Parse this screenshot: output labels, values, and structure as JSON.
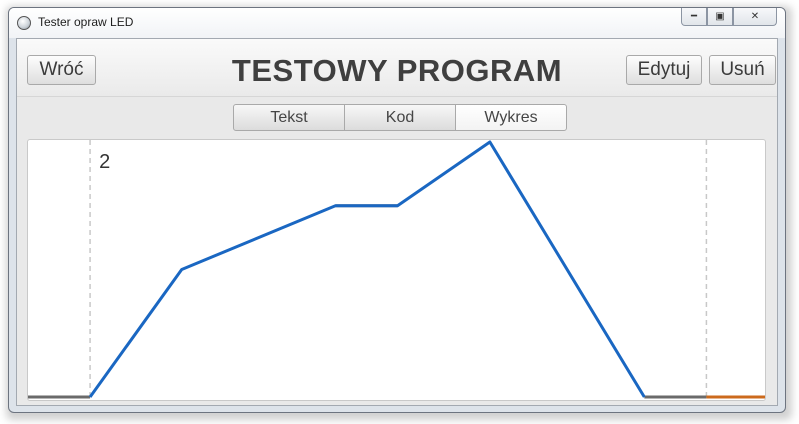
{
  "window": {
    "title": "Tester opraw LED",
    "controls": {
      "minimize_icon": "minimize-icon",
      "maximize_icon": "maximize-icon",
      "close_icon": "close-icon"
    }
  },
  "header": {
    "title": "TESTOWY PROGRAM",
    "back_label": "Wróć",
    "edit_label": "Edytuj",
    "delete_label": "Usuń"
  },
  "tabs": [
    {
      "label": "Tekst",
      "active": false
    },
    {
      "label": "Kod",
      "active": false
    },
    {
      "label": "Wykres",
      "active": true
    }
  ],
  "chart_data": {
    "type": "line",
    "segment_label": "2",
    "ylim": [
      0,
      100
    ],
    "xlim": [
      0,
      100
    ],
    "series": [
      {
        "color": "#1a67c2",
        "points": [
          [
            8.4,
            0
          ],
          [
            20.8,
            50
          ],
          [
            41.6,
            75
          ],
          [
            50.0,
            75
          ],
          [
            62.5,
            100
          ],
          [
            83.4,
            0
          ]
        ]
      }
    ],
    "flat_segments": [
      {
        "color": "#6a6a6a",
        "points": [
          [
            0,
            0
          ],
          [
            8.4,
            0
          ]
        ]
      },
      {
        "color": "#6a6a6a",
        "points": [
          [
            41.6,
            75
          ],
          [
            50.0,
            75
          ]
        ]
      },
      {
        "color": "#6a6a6a",
        "points": [
          [
            83.4,
            0
          ],
          [
            91.8,
            0
          ]
        ]
      },
      {
        "color": "#cc6a1c",
        "points": [
          [
            91.8,
            0
          ],
          [
            100,
            0
          ]
        ]
      }
    ],
    "markers": [
      8.4,
      91.8
    ],
    "grid": false
  }
}
